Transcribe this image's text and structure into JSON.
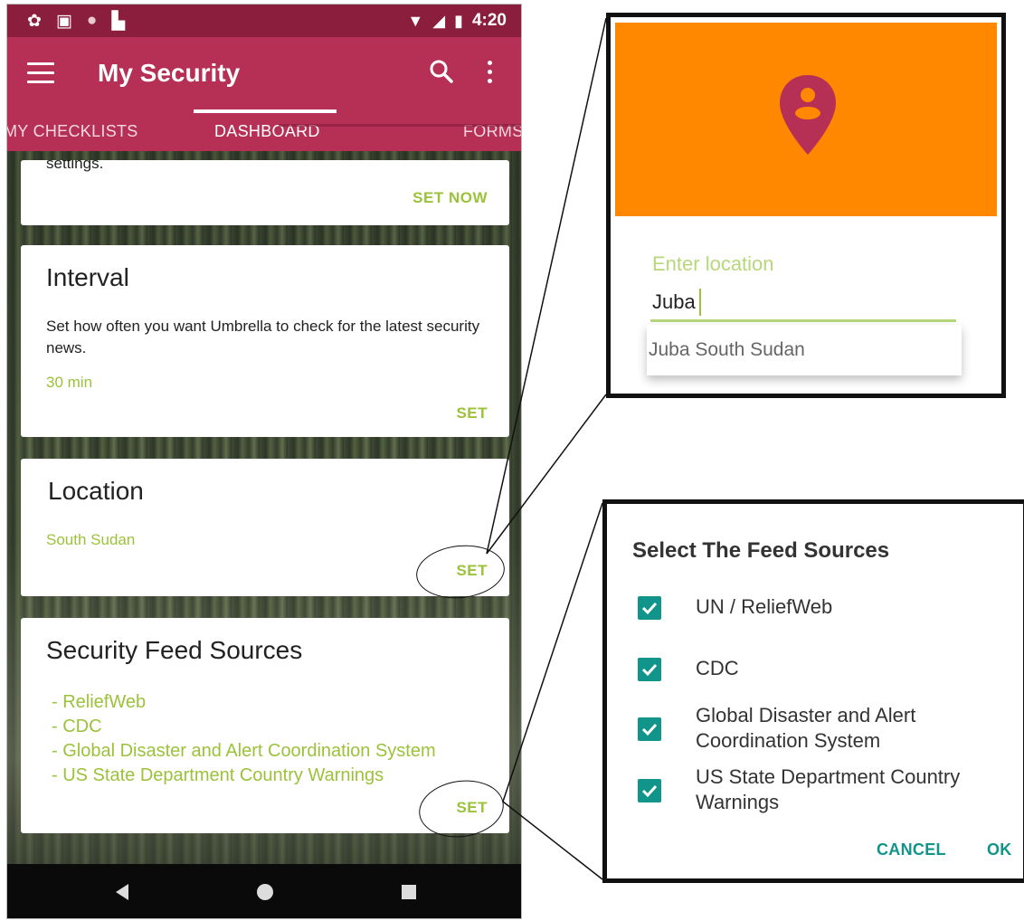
{
  "statusbar": {
    "time": "4:20",
    "icons": [
      "gear-icon",
      "photo-icon",
      "circle-icon",
      "sd-card-icon",
      "wifi-icon",
      "signal-icon",
      "battery-icon"
    ]
  },
  "appbar": {
    "title": "My Security",
    "tabs": [
      {
        "label": "MY CHECKLISTS",
        "active": false
      },
      {
        "label": "DASHBOARD",
        "active": true
      },
      {
        "label": "FORMS",
        "active": false
      }
    ]
  },
  "cards": {
    "notifications": {
      "partial_text": "settings.",
      "action": "SET NOW"
    },
    "interval": {
      "title": "Interval",
      "description": "Set how often you want Umbrella to check for the latest security news.",
      "value": "30 min",
      "action": "SET"
    },
    "location": {
      "title": "Location",
      "value": "South Sudan",
      "action": "SET"
    },
    "feeds": {
      "title": "Security Feed Sources",
      "items": [
        "- ReliefWeb",
        "- CDC",
        "- Global Disaster and Alert Coordination System",
        "- US State Department Country Warnings"
      ],
      "action": "SET"
    }
  },
  "location_dialog": {
    "label": "Enter location",
    "input_value": "Juba",
    "suggestion": "Juba South Sudan",
    "header_color": "#ff8800",
    "icon": "location-pin-icon"
  },
  "feed_dialog": {
    "title": "Select The Feed Sources",
    "options": [
      {
        "label": "UN / ReliefWeb",
        "checked": true
      },
      {
        "label": "CDC",
        "checked": true
      },
      {
        "label": "Global Disaster and Alert Coordination System",
        "checked": true
      },
      {
        "label": "US State Department Country Warnings",
        "checked": true
      }
    ],
    "cancel_label": "CANCEL",
    "ok_label": "OK"
  },
  "colors": {
    "primary": "#b62f55",
    "primary_dark": "#8c1e3d",
    "accent": "#9bc23a",
    "teal": "#119489"
  }
}
